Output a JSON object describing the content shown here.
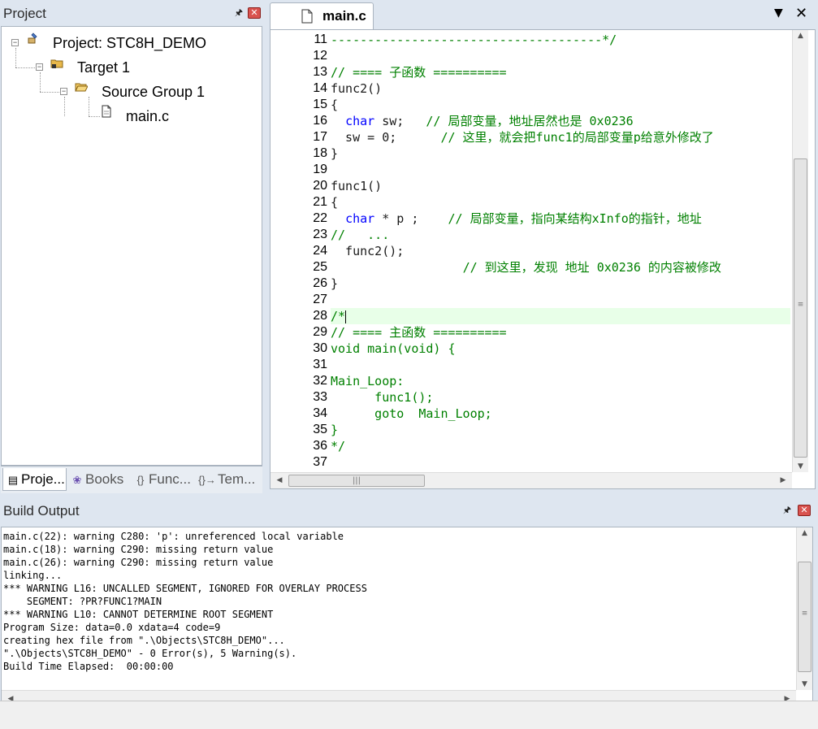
{
  "project_panel": {
    "title": "Project",
    "tree": {
      "project": "Project: STC8H_DEMO",
      "target": "Target 1",
      "group": "Source Group 1",
      "file": "main.c"
    },
    "tabs": [
      {
        "label": "Proje...",
        "icon": "project-icon"
      },
      {
        "label": "Books",
        "icon": "books-icon"
      },
      {
        "label": "Func...",
        "icon": "functions-icon"
      },
      {
        "label": "Tem...",
        "icon": "templates-icon"
      }
    ]
  },
  "editor": {
    "tab_label": "main.c",
    "lines": [
      {
        "n": "11",
        "segs": [
          {
            "t": "-------------------------------------*/",
            "c": "cm"
          }
        ]
      },
      {
        "n": "12",
        "segs": []
      },
      {
        "n": "13",
        "segs": [
          {
            "t": "// ==== 子函数 ==========",
            "c": "cm"
          }
        ]
      },
      {
        "n": "14",
        "segs": [
          {
            "t": "func2()",
            "c": ""
          }
        ]
      },
      {
        "n": "15",
        "segs": [
          {
            "t": "{",
            "c": ""
          }
        ]
      },
      {
        "n": "16",
        "segs": [
          {
            "t": "  ",
            "c": ""
          },
          {
            "t": "char",
            "c": "kw"
          },
          {
            "t": " sw;   ",
            "c": ""
          },
          {
            "t": "// 局部变量，地址居然也是 0x0236",
            "c": "cm"
          }
        ]
      },
      {
        "n": "17",
        "segs": [
          {
            "t": "  sw = ",
            "c": ""
          },
          {
            "t": "0",
            "c": "num"
          },
          {
            "t": ";      ",
            "c": ""
          },
          {
            "t": "// 这里，就会把func1的局部变量p给意外修改了",
            "c": "cm"
          }
        ]
      },
      {
        "n": "18",
        "segs": [
          {
            "t": "}",
            "c": ""
          }
        ]
      },
      {
        "n": "19",
        "segs": []
      },
      {
        "n": "20",
        "segs": [
          {
            "t": "func1()",
            "c": ""
          }
        ]
      },
      {
        "n": "21",
        "segs": [
          {
            "t": "{",
            "c": ""
          }
        ]
      },
      {
        "n": "22",
        "segs": [
          {
            "t": "  ",
            "c": ""
          },
          {
            "t": "char",
            "c": "kw"
          },
          {
            "t": " * p ;    ",
            "c": ""
          },
          {
            "t": "// 局部变量，指向某结构xInfo的指针，地址",
            "c": "cm"
          }
        ]
      },
      {
        "n": "23",
        "segs": [
          {
            "t": "//   ...",
            "c": "cm"
          }
        ]
      },
      {
        "n": "24",
        "segs": [
          {
            "t": "  func2();",
            "c": ""
          }
        ]
      },
      {
        "n": "25",
        "segs": [
          {
            "t": "                  ",
            "c": ""
          },
          {
            "t": "// 到这里，发现 地址 0x0236 的内容被修改",
            "c": "cm"
          }
        ]
      },
      {
        "n": "26",
        "segs": [
          {
            "t": "}",
            "c": ""
          }
        ]
      },
      {
        "n": "27",
        "segs": []
      },
      {
        "n": "28",
        "segs": [
          {
            "t": "/*",
            "c": "cm"
          }
        ],
        "highlight": true
      },
      {
        "n": "29",
        "segs": [
          {
            "t": "// ==== 主函数 ==========",
            "c": "cm"
          }
        ]
      },
      {
        "n": "30",
        "segs": [
          {
            "t": "void main(void) {",
            "c": "cm"
          }
        ]
      },
      {
        "n": "31",
        "segs": []
      },
      {
        "n": "32",
        "segs": [
          {
            "t": "Main_Loop:",
            "c": "cm"
          }
        ]
      },
      {
        "n": "33",
        "segs": [
          {
            "t": "      func1();",
            "c": "cm"
          }
        ]
      },
      {
        "n": "34",
        "segs": [
          {
            "t": "      goto  Main_Loop;",
            "c": "cm"
          }
        ]
      },
      {
        "n": "35",
        "segs": [
          {
            "t": "}",
            "c": "cm"
          }
        ]
      },
      {
        "n": "36",
        "segs": [
          {
            "t": "*/",
            "c": "cm"
          }
        ]
      },
      {
        "n": "37",
        "segs": []
      }
    ]
  },
  "build_output": {
    "title": "Build Output",
    "lines": [
      "main.c(22): warning C280: 'p': unreferenced local variable",
      "main.c(18): warning C290: missing return value",
      "main.c(26): warning C290: missing return value",
      "linking...",
      "*** WARNING L16: UNCALLED SEGMENT, IGNORED FOR OVERLAY PROCESS",
      "    SEGMENT: ?PR?FUNC1?MAIN",
      "*** WARNING L10: CANNOT DETERMINE ROOT SEGMENT",
      "Program Size: data=0.0 xdata=4 code=9",
      "creating hex file from \".\\Objects\\STC8H_DEMO\"...",
      "\".\\Objects\\STC8H_DEMO\" - 0 Error(s), 5 Warning(s).",
      "Build Time Elapsed:  00:00:00"
    ]
  },
  "colors": {
    "keyword": "#0000ff",
    "comment": "#008000",
    "current_line": "#e8ffe8",
    "panel_bg": "#dee6f0"
  }
}
